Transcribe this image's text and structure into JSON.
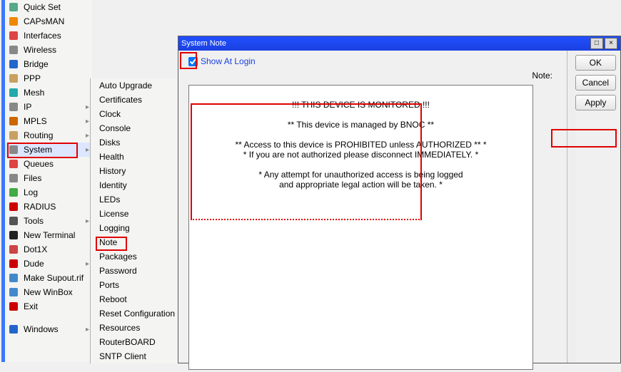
{
  "sidebar": {
    "items": [
      {
        "icon": "wand",
        "label": "Quick Set",
        "sub": false
      },
      {
        "icon": "antenna",
        "label": "CAPsMAN",
        "sub": false
      },
      {
        "icon": "bars",
        "label": "Interfaces",
        "sub": false
      },
      {
        "icon": "wifi",
        "label": "Wireless",
        "sub": false
      },
      {
        "icon": "bridge",
        "label": "Bridge",
        "sub": false
      },
      {
        "icon": "ppp",
        "label": "PPP",
        "sub": false
      },
      {
        "icon": "mesh",
        "label": "Mesh",
        "sub": false
      },
      {
        "icon": "ip",
        "label": "IP",
        "sub": true
      },
      {
        "icon": "mpls",
        "label": "MPLS",
        "sub": true
      },
      {
        "icon": "routing",
        "label": "Routing",
        "sub": true
      },
      {
        "icon": "gear",
        "label": "System",
        "sub": true
      },
      {
        "icon": "queue",
        "label": "Queues",
        "sub": false
      },
      {
        "icon": "files",
        "label": "Files",
        "sub": false
      },
      {
        "icon": "log",
        "label": "Log",
        "sub": false
      },
      {
        "icon": "radius",
        "label": "RADIUS",
        "sub": false
      },
      {
        "icon": "tools",
        "label": "Tools",
        "sub": true
      },
      {
        "icon": "terminal",
        "label": "New Terminal",
        "sub": false
      },
      {
        "icon": "dot1x",
        "label": "Dot1X",
        "sub": false
      },
      {
        "icon": "dude",
        "label": "Dude",
        "sub": true
      },
      {
        "icon": "supout",
        "label": "Make Supout.rif",
        "sub": false
      },
      {
        "icon": "winbox",
        "label": "New WinBox",
        "sub": false
      },
      {
        "icon": "exit",
        "label": "Exit",
        "sub": false
      },
      {
        "icon": "spacer",
        "label": "",
        "sub": false
      },
      {
        "icon": "windows",
        "label": "Windows",
        "sub": true
      }
    ]
  },
  "submenu": {
    "items": [
      "Auto Upgrade",
      "Certificates",
      "Clock",
      "Console",
      "Disks",
      "Health",
      "History",
      "Identity",
      "LEDs",
      "License",
      "Logging",
      "Note",
      "Packages",
      "Password",
      "Ports",
      "Reboot",
      "Reset Configuration",
      "Resources",
      "RouterBOARD",
      "SNTP Client"
    ]
  },
  "window": {
    "title": "System Note",
    "checkbox_label": "Show At Login",
    "checkbox_checked": true,
    "note_label": "Note:",
    "note_text": "!!! THIS DEVICE IS MONITORED !!!\n\n** This device is managed by BNOC **\n\n** Access to this device is PROHIBITED unless AUTHORIZED ** *\n* If you are not authorized please disconnect IMMEDIATELY. *\n\n* Any attempt for unauthorized access is being logged\nand appropriate legal action will be taken. *",
    "buttons": {
      "ok": "OK",
      "cancel": "Cancel",
      "apply": "Apply"
    }
  }
}
